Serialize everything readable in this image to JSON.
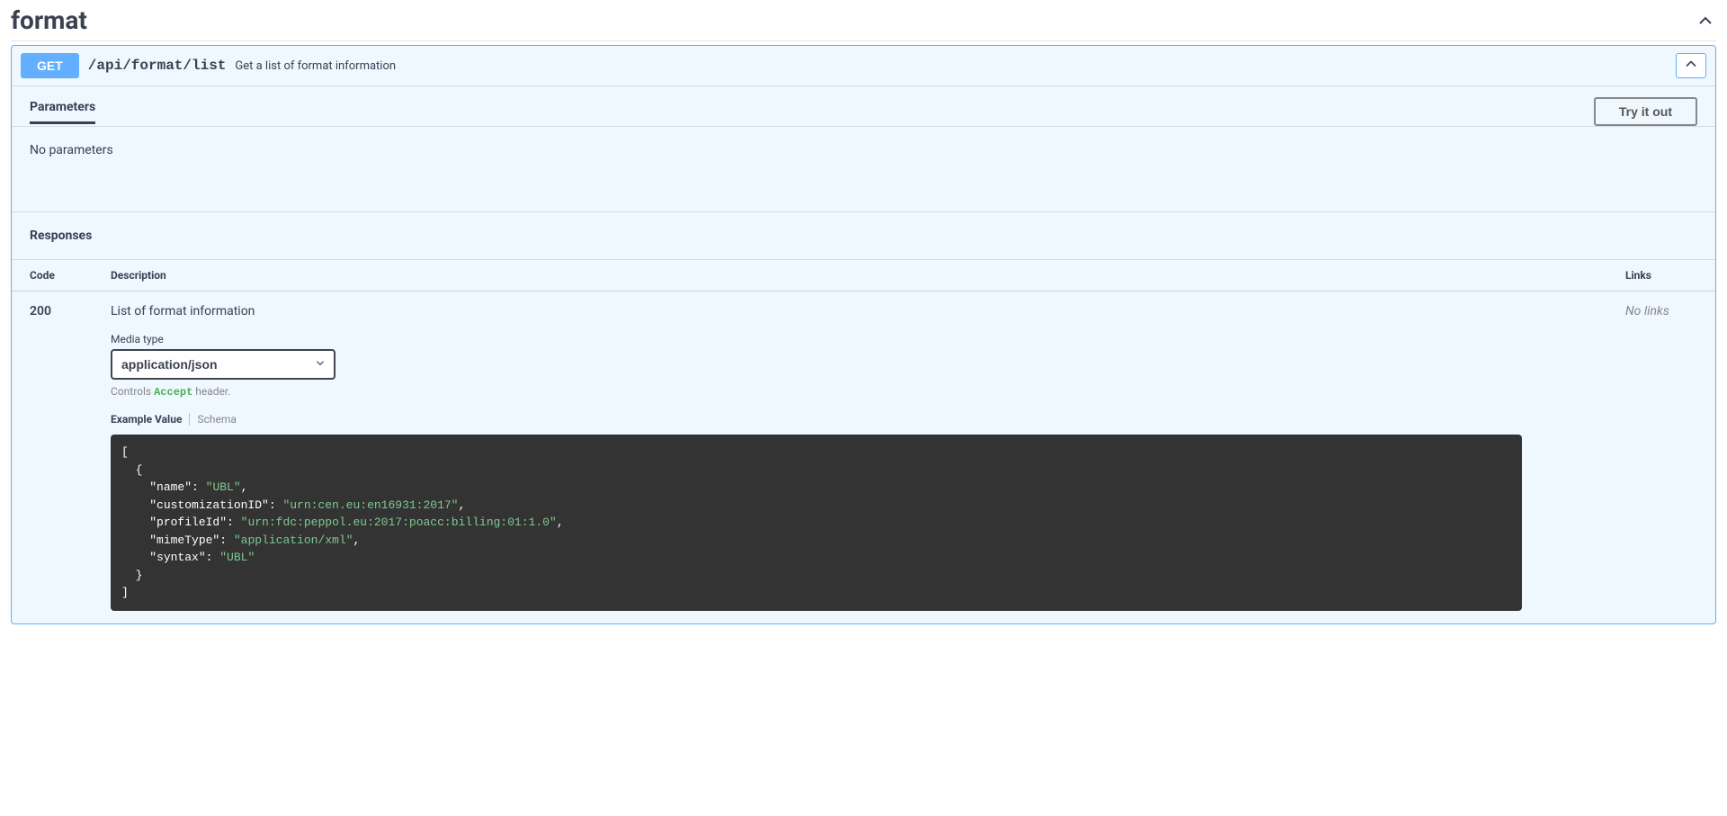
{
  "section": {
    "title": "format"
  },
  "endpoint": {
    "method": "GET",
    "path": "/api/format/list",
    "summary": "Get a list of format information"
  },
  "parameters": {
    "tab_label": "Parameters",
    "try_label": "Try it out",
    "empty_text": "No parameters"
  },
  "responses": {
    "title": "Responses",
    "headers": {
      "code": "Code",
      "description": "Description",
      "links": "Links"
    },
    "rows": [
      {
        "code": "200",
        "description": "List of format information",
        "media_type_label": "Media type",
        "media_type_value": "application/json",
        "controls_prefix": "Controls ",
        "controls_accept": "Accept",
        "controls_suffix": " header.",
        "tab_example": "Example Value",
        "tab_schema": "Schema",
        "example": {
          "lines": [
            {
              "indent": 0,
              "text": "["
            },
            {
              "indent": 1,
              "text": "{"
            },
            {
              "indent": 2,
              "key": "\"name\"",
              "sep": ": ",
              "val": "\"UBL\"",
              "comma": ","
            },
            {
              "indent": 2,
              "key": "\"customizationID\"",
              "sep": ": ",
              "val": "\"urn:cen.eu:en16931:2017\"",
              "comma": ","
            },
            {
              "indent": 2,
              "key": "\"profileId\"",
              "sep": ": ",
              "val": "\"urn:fdc:peppol.eu:2017:poacc:billing:01:1.0\"",
              "comma": ","
            },
            {
              "indent": 2,
              "key": "\"mimeType\"",
              "sep": ": ",
              "val": "\"application/xml\"",
              "comma": ","
            },
            {
              "indent": 2,
              "key": "\"syntax\"",
              "sep": ": ",
              "val": "\"UBL\"",
              "comma": ""
            },
            {
              "indent": 1,
              "text": "}"
            },
            {
              "indent": 0,
              "text": "]"
            }
          ]
        },
        "links": "No links"
      }
    ]
  }
}
